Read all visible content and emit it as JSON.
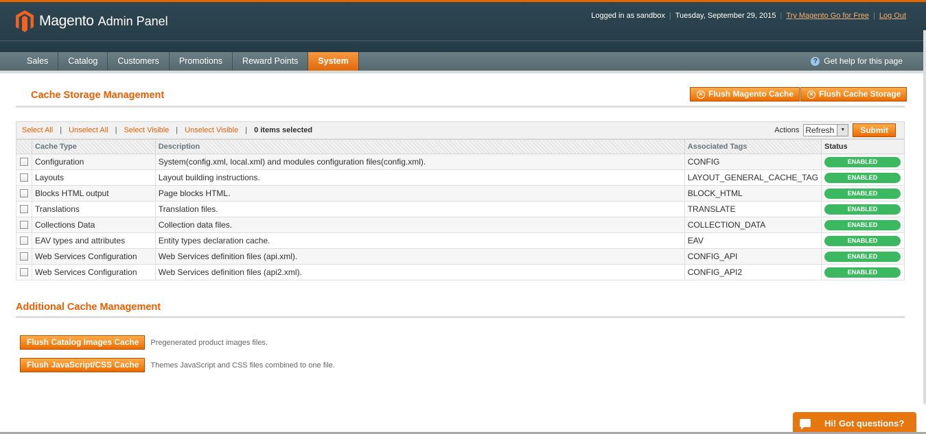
{
  "header": {
    "logo_text": "Magento",
    "logo_sub": "Admin Panel",
    "logged_in": "Logged in as sandbox",
    "date": "Tuesday, September 29, 2015",
    "try_link": "Try Magento Go for Free",
    "logout": "Log Out"
  },
  "nav": {
    "items": [
      "Sales",
      "Catalog",
      "Customers",
      "Promotions",
      "Reward Points",
      "System"
    ],
    "active": "System",
    "help": "Get help for this page"
  },
  "page": {
    "title": "Cache Storage Management",
    "flush_magento": "Flush Magento Cache",
    "flush_storage": "Flush Cache Storage"
  },
  "massaction": {
    "select_all": "Select All",
    "unselect_all": "Unselect All",
    "select_visible": "Select Visible",
    "unselect_visible": "Unselect Visible",
    "count": "0 items selected",
    "actions_label": "Actions",
    "actions_value": "Refresh",
    "submit": "Submit"
  },
  "grid": {
    "headers": [
      "Cache Type",
      "Description",
      "Associated Tags",
      "Status"
    ],
    "rows": [
      {
        "type": "Configuration",
        "desc": "System(config.xml, local.xml) and modules configuration files(config.xml).",
        "tags": "CONFIG",
        "status": "ENABLED"
      },
      {
        "type": "Layouts",
        "desc": "Layout building instructions.",
        "tags": "LAYOUT_GENERAL_CACHE_TAG",
        "status": "ENABLED"
      },
      {
        "type": "Blocks HTML output",
        "desc": "Page blocks HTML.",
        "tags": "BLOCK_HTML",
        "status": "ENABLED"
      },
      {
        "type": "Translations",
        "desc": "Translation files.",
        "tags": "TRANSLATE",
        "status": "ENABLED"
      },
      {
        "type": "Collections Data",
        "desc": "Collection data files.",
        "tags": "COLLECTION_DATA",
        "status": "ENABLED"
      },
      {
        "type": "EAV types and attributes",
        "desc": "Entity types declaration cache.",
        "tags": "EAV",
        "status": "ENABLED"
      },
      {
        "type": "Web Services Configuration",
        "desc": "Web Services definition files (api.xml).",
        "tags": "CONFIG_API",
        "status": "ENABLED"
      },
      {
        "type": "Web Services Configuration",
        "desc": "Web Services definition files (api2.xml).",
        "tags": "CONFIG_API2",
        "status": "ENABLED"
      }
    ]
  },
  "additional": {
    "title": "Additional Cache Management",
    "images_btn": "Flush Catalog Images Cache",
    "images_note": "Pregenerated product images files.",
    "js_btn": "Flush JavaScript/CSS Cache",
    "js_note": "Themes JavaScript and CSS files combined to one file."
  },
  "chat": {
    "label": "Hi! Got questions?"
  },
  "colors": {
    "accent": "#eb5e00",
    "header_bg": "#2e4651",
    "enabled": "#3cb861"
  }
}
